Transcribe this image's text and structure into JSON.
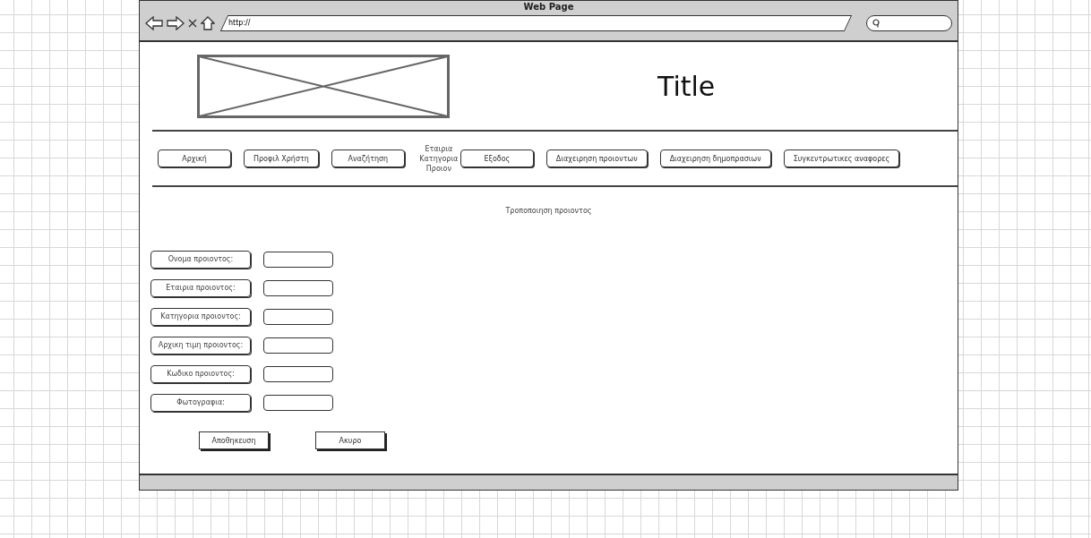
{
  "window": {
    "title": "Web Page",
    "address": "http://"
  },
  "header": {
    "title": "Title"
  },
  "nav": [
    {
      "kind": "button",
      "label": "Αρχική"
    },
    {
      "kind": "button",
      "label": "Προφιλ Χρήστη"
    },
    {
      "kind": "button",
      "label": "Αναζήτηση"
    },
    {
      "kind": "text",
      "label": "Εταιρια Κατηγορια Προιον"
    },
    {
      "kind": "button",
      "label": "Εξοδος"
    },
    {
      "kind": "button",
      "label": "Διαχειρηση προιοντων"
    },
    {
      "kind": "button",
      "label": "Διαχειρηση δημοπρασιων"
    },
    {
      "kind": "button",
      "label": "Συγκεντρωτικες αναφορες"
    }
  ],
  "page_heading": "Τροποποιηση προιοντος",
  "form": {
    "fields": [
      {
        "label": "Ονομα προιοντος:"
      },
      {
        "label": "Εταιρια προιοντος:"
      },
      {
        "label": "Κατηγορια προιοντος:"
      },
      {
        "label": "Αρχικη τιμη προιοντος:"
      },
      {
        "label": "Κωδικο προιοντος:"
      },
      {
        "label": "Φωτογραφια:"
      }
    ],
    "buttons": [
      {
        "label": "Αποθηκευση"
      },
      {
        "label": "Ακυρο"
      }
    ]
  }
}
